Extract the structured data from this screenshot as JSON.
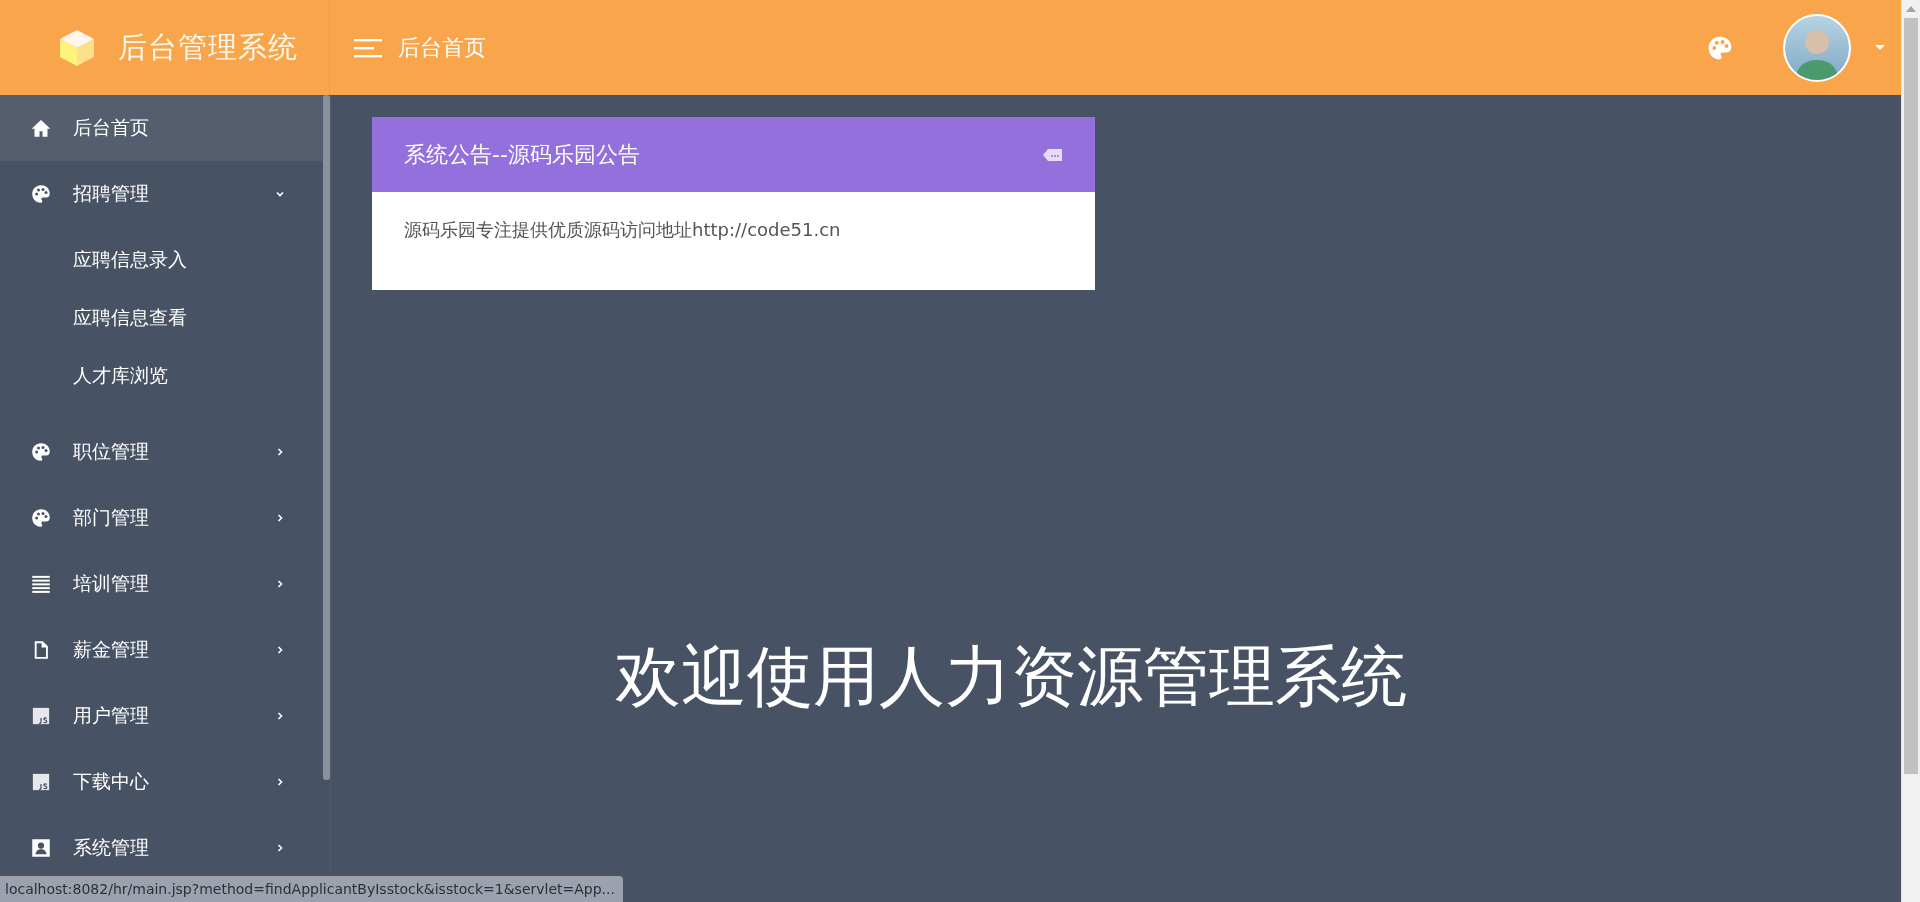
{
  "header": {
    "title": "后台管理系统",
    "breadcrumb": "后台首页"
  },
  "sidebar": {
    "items": [
      {
        "label": "后台首页",
        "kind": "home",
        "selected": true
      },
      {
        "label": "招聘管理",
        "kind": "palette",
        "selected": false,
        "expanded": true,
        "children": [
          {
            "label": "应聘信息录入"
          },
          {
            "label": "应聘信息查看"
          },
          {
            "label": "人才库浏览"
          }
        ]
      },
      {
        "label": "职位管理",
        "kind": "palette",
        "selected": false,
        "expanded": false
      },
      {
        "label": "部门管理",
        "kind": "palette",
        "selected": false,
        "expanded": false
      },
      {
        "label": "培训管理",
        "kind": "lines",
        "selected": false,
        "expanded": false
      },
      {
        "label": "薪金管理",
        "kind": "file",
        "selected": false,
        "expanded": false
      },
      {
        "label": "用户管理",
        "kind": "js",
        "selected": false,
        "expanded": false
      },
      {
        "label": "下载中心",
        "kind": "js",
        "selected": false,
        "expanded": false
      },
      {
        "label": "系统管理",
        "kind": "card",
        "selected": false,
        "expanded": false
      }
    ]
  },
  "notice": {
    "title": "系统公告--源码乐园公告",
    "body": "源码乐园专注提供优质源码访问地址http://code51.cn"
  },
  "welcome": "欢迎使用人力资源管理系统",
  "status_bar": "localhost:8082/hr/main.jsp?method=findApplicantByIsstock&isstock=1&servlet=App..."
}
